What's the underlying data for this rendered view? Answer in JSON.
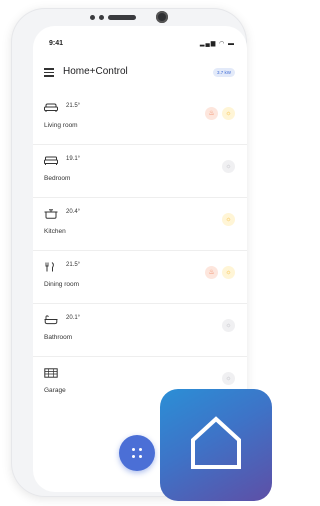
{
  "status_bar": {
    "time": "9:41",
    "icons": [
      "signal-icon",
      "wifi-icon",
      "battery-icon"
    ]
  },
  "app_bar": {
    "title": "Home+Control",
    "power_badge": "3.7 kW",
    "menu_icon": "menu-icon"
  },
  "rooms": [
    {
      "name": "Living room",
      "temperature": "21.5°",
      "icon": "sofa-icon",
      "heating": true,
      "light_on": true
    },
    {
      "name": "Bedroom",
      "temperature": "19.1°",
      "icon": "bed-icon",
      "heating": false,
      "light_on": false
    },
    {
      "name": "Kitchen",
      "temperature": "20.4°",
      "icon": "cooking-pot-icon",
      "heating": false,
      "light_on": true
    },
    {
      "name": "Dining room",
      "temperature": "21.5°",
      "icon": "cutlery-icon",
      "heating": true,
      "light_on": true
    },
    {
      "name": "Bathroom",
      "temperature": "20.1°",
      "icon": "bathtub-icon",
      "heating": false,
      "light_on": false
    },
    {
      "name": "Garage",
      "temperature": "",
      "icon": "garage-icon",
      "heating": false,
      "light_on": false
    }
  ],
  "fab": {
    "icon": "grid-dots-icon"
  },
  "logo": {
    "icon": "house-icon"
  },
  "colors": {
    "accent": "#4b6fd6",
    "heating": "#ef8159",
    "light_on": "#f5b52e",
    "light_off": "#b9b9bf",
    "logo_gradient_start": "#2b8fd6",
    "logo_gradient_end": "#5e4fa6"
  }
}
